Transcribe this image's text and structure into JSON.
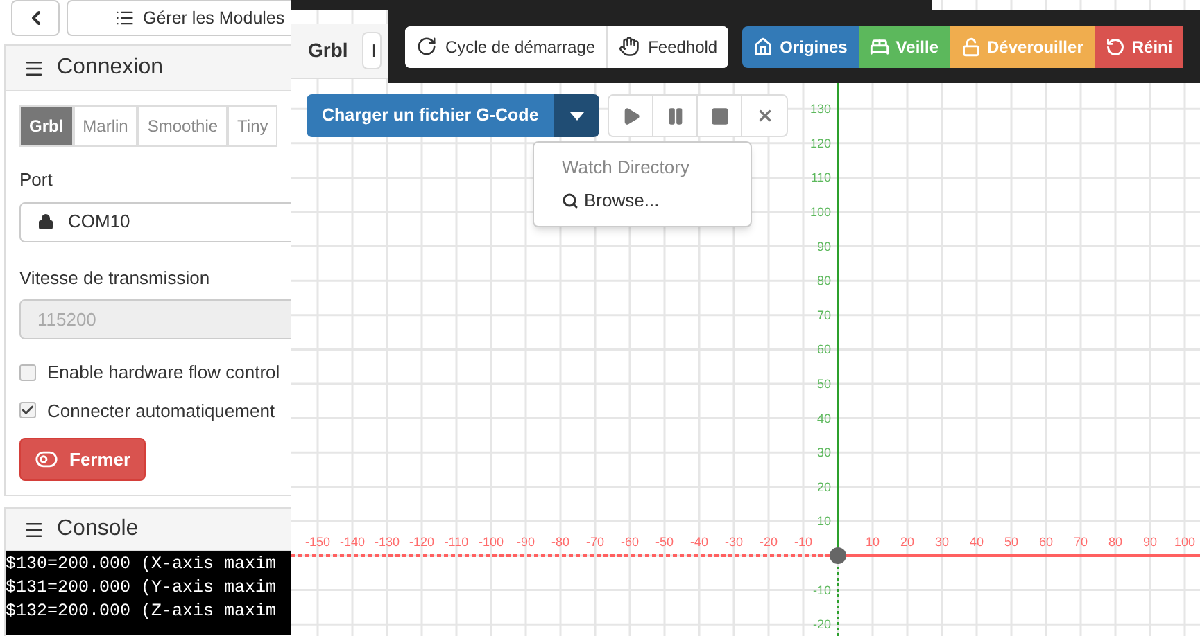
{
  "nav": {
    "manage_modules": "Gérer les Modules"
  },
  "connection": {
    "title": "Connexion",
    "tabs": [
      {
        "label": "Grbl",
        "selected": true
      },
      {
        "label": "Marlin",
        "selected": false
      },
      {
        "label": "Smoothie",
        "selected": false
      },
      {
        "label": "Tiny",
        "selected": false
      }
    ],
    "port_label": "Port",
    "port_value": "COM10",
    "baud_label": "Vitesse de transmission",
    "baud_value": "115200",
    "baud_disabled": true,
    "options": [
      {
        "label": "Enable hardware flow control",
        "checked": false
      },
      {
        "label": "Connecter automatiquement",
        "checked": true
      }
    ],
    "close_button": "Fermer"
  },
  "console": {
    "title": "Console",
    "lines": [
      "$130=200.000 (X-axis maxim",
      "$131=200.000 (Y-axis maxim",
      "$132=200.000 (Z-axis maxim"
    ]
  },
  "workspace": {
    "title": "Grbl",
    "tab_fragment": "I",
    "load_button": "Charger un fichier G-Code",
    "menu": [
      {
        "label": "Watch Directory",
        "kind": "header"
      },
      {
        "label": "Browse...",
        "kind": "action"
      }
    ]
  },
  "toolbar": {
    "buttons": [
      {
        "label": "Cycle de démarrage",
        "kind": "plain"
      },
      {
        "label": "Feedhold",
        "kind": "plain"
      },
      {
        "label": "Origines",
        "kind": "primary"
      },
      {
        "label": "Veille",
        "kind": "success"
      },
      {
        "label": "Déverouiller",
        "kind": "warning"
      },
      {
        "label": "Réini",
        "kind": "danger"
      }
    ]
  },
  "visualizer": {
    "x_negative": [
      "-150",
      "-140",
      "-130",
      "-120",
      "-110",
      "-100",
      "-90",
      "-80",
      "-70",
      "-60",
      "-50",
      "-40",
      "-30",
      "-20",
      "-10"
    ],
    "x_positive": [
      "10",
      "20",
      "30",
      "40",
      "50",
      "60",
      "70",
      "80",
      "90",
      "100"
    ],
    "y_positive": [
      "130",
      "120",
      "110",
      "100",
      "90",
      "80",
      "70",
      "60",
      "50",
      "40",
      "30",
      "20",
      "10"
    ],
    "y_negative": [
      "-10",
      "-20"
    ]
  }
}
